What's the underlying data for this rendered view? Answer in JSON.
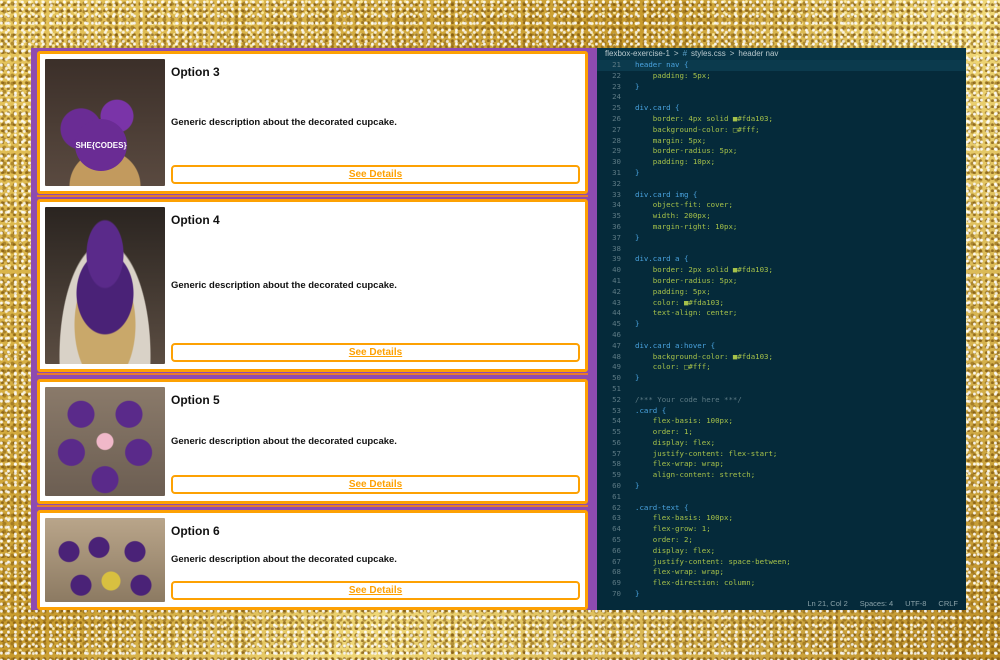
{
  "cards": [
    {
      "title": "Option 3",
      "desc": "Generic description about the decorated cupcake.",
      "link": "See Details",
      "badge": "SHE{CODES}"
    },
    {
      "title": "Option 4",
      "desc": "Generic description about the decorated cupcake.",
      "link": "See Details"
    },
    {
      "title": "Option 5",
      "desc": "Generic description about the decorated cupcake.",
      "link": "See Details"
    },
    {
      "title": "Option 6",
      "desc": "Generic description about the decorated cupcake.",
      "link": "See Details"
    }
  ],
  "editor": {
    "breadcrumb": [
      "flexbox-exercise-1",
      ">",
      "#",
      "styles.css",
      ">",
      "header nav"
    ],
    "lines": [
      {
        "n": "21",
        "t": "header nav {"
      },
      {
        "n": "22",
        "t": "    padding: 5px;"
      },
      {
        "n": "23",
        "t": "}"
      },
      {
        "n": "24",
        "t": ""
      },
      {
        "n": "25",
        "t": "div.card {"
      },
      {
        "n": "26",
        "t": "    border: 4px solid ■#fda103;"
      },
      {
        "n": "27",
        "t": "    background-color: □#fff;"
      },
      {
        "n": "28",
        "t": "    margin: 5px;"
      },
      {
        "n": "29",
        "t": "    border-radius: 5px;"
      },
      {
        "n": "30",
        "t": "    padding: 10px;"
      },
      {
        "n": "31",
        "t": "}"
      },
      {
        "n": "32",
        "t": ""
      },
      {
        "n": "33",
        "t": "div.card img {"
      },
      {
        "n": "34",
        "t": "    object-fit: cover;"
      },
      {
        "n": "35",
        "t": "    width: 200px;"
      },
      {
        "n": "36",
        "t": "    margin-right: 10px;"
      },
      {
        "n": "37",
        "t": "}"
      },
      {
        "n": "38",
        "t": ""
      },
      {
        "n": "39",
        "t": "div.card a {"
      },
      {
        "n": "40",
        "t": "    border: 2px solid ■#fda103;"
      },
      {
        "n": "41",
        "t": "    border-radius: 5px;"
      },
      {
        "n": "42",
        "t": "    padding: 5px;"
      },
      {
        "n": "43",
        "t": "    color: ■#fda103;"
      },
      {
        "n": "44",
        "t": "    text-align: center;"
      },
      {
        "n": "45",
        "t": "}"
      },
      {
        "n": "46",
        "t": ""
      },
      {
        "n": "47",
        "t": "div.card a:hover {"
      },
      {
        "n": "48",
        "t": "    background-color: ■#fda103;"
      },
      {
        "n": "49",
        "t": "    color: □#fff;"
      },
      {
        "n": "50",
        "t": "}"
      },
      {
        "n": "51",
        "t": ""
      },
      {
        "n": "52",
        "t": "/*** Your code here ***/"
      },
      {
        "n": "53",
        "t": ".card {"
      },
      {
        "n": "54",
        "t": "    flex-basis: 100px;"
      },
      {
        "n": "55",
        "t": "    order: 1;"
      },
      {
        "n": "56",
        "t": "    display: flex;"
      },
      {
        "n": "57",
        "t": "    justify-content: flex-start;"
      },
      {
        "n": "58",
        "t": "    flex-wrap: wrap;"
      },
      {
        "n": "59",
        "t": "    align-content: stretch;"
      },
      {
        "n": "60",
        "t": "}"
      },
      {
        "n": "61",
        "t": ""
      },
      {
        "n": "62",
        "t": ".card-text {"
      },
      {
        "n": "63",
        "t": "    flex-basis: 100px;"
      },
      {
        "n": "64",
        "t": "    flex-grow: 1;"
      },
      {
        "n": "65",
        "t": "    order: 2;"
      },
      {
        "n": "66",
        "t": "    display: flex;"
      },
      {
        "n": "67",
        "t": "    justify-content: space-between;"
      },
      {
        "n": "68",
        "t": "    flex-wrap: wrap;"
      },
      {
        "n": "69",
        "t": "    flex-direction: column;"
      },
      {
        "n": "70",
        "t": "}"
      }
    ],
    "status": [
      "Ln 21, Col 2",
      "Spaces: 4",
      "UTF-8",
      "CRLF"
    ]
  },
  "colors": {
    "accent": "#fda103",
    "purple": "#8e4bb0",
    "editor_bg": "#052a3a"
  }
}
